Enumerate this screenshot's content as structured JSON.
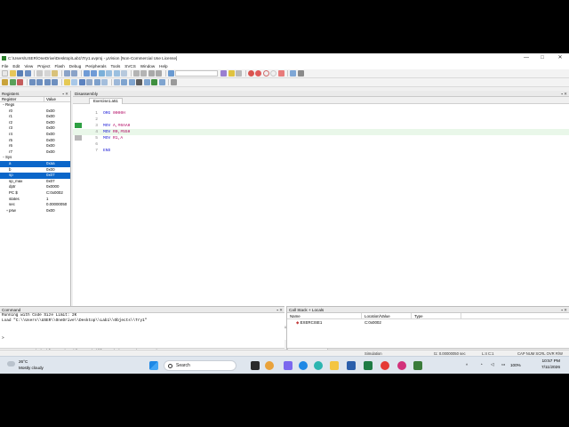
{
  "window": {
    "title": "C:\\Users\\USER\\OneDrive\\Desktop\\Lab1\\Try1.uvproj - µVision  [Non-Commercial Use License]",
    "minimize": "—",
    "maximize": "□",
    "close": "✕"
  },
  "menu": [
    "File",
    "Edit",
    "View",
    "Project",
    "Flash",
    "Debug",
    "Peripherals",
    "Tools",
    "SVCS",
    "Window",
    "Help"
  ],
  "registers": {
    "header": "Registers",
    "col_register": "Register",
    "col_value": "Value",
    "rows": [
      {
        "name": "Regs",
        "value": "",
        "indent": 0,
        "expander": "−"
      },
      {
        "name": "r0",
        "value": "0x00",
        "indent": 2
      },
      {
        "name": "r1",
        "value": "0x00",
        "indent": 2
      },
      {
        "name": "r2",
        "value": "0x00",
        "indent": 2
      },
      {
        "name": "r3",
        "value": "0x00",
        "indent": 2
      },
      {
        "name": "r4",
        "value": "0x00",
        "indent": 2
      },
      {
        "name": "r5",
        "value": "0x00",
        "indent": 2
      },
      {
        "name": "r6",
        "value": "0x00",
        "indent": 2
      },
      {
        "name": "r7",
        "value": "0x00",
        "indent": 2
      },
      {
        "name": "Sys",
        "value": "",
        "indent": 0,
        "expander": "−"
      },
      {
        "name": "a",
        "value": "0xaa",
        "indent": 2,
        "selected": true
      },
      {
        "name": "b",
        "value": "0x00",
        "indent": 2
      },
      {
        "name": "sp",
        "value": "0x07",
        "indent": 2,
        "selected": true
      },
      {
        "name": "sp_max",
        "value": "0x07",
        "indent": 2
      },
      {
        "name": "dptr",
        "value": "0x0000",
        "indent": 2
      },
      {
        "name": "PC  $",
        "value": "C:0x0002",
        "indent": 2
      },
      {
        "name": "states",
        "value": "1",
        "indent": 2
      },
      {
        "name": "sec",
        "value": "0.00000050",
        "indent": 2
      },
      {
        "name": "psw",
        "value": "0x00",
        "indent": 1,
        "expander": "+"
      }
    ],
    "tabs": [
      "Project",
      "Registers"
    ]
  },
  "disassembly": {
    "header": "Disassembly",
    "file_tab": "Exercise1.a51",
    "lines": [
      {
        "num": "1",
        "code": "ORG 0000H"
      },
      {
        "num": "2",
        "code": ""
      },
      {
        "num": "3",
        "code": "MOV A,#0AAH"
      },
      {
        "num": "4",
        "code": "MOV R0,#55H",
        "current": true
      },
      {
        "num": "5",
        "code": "MOV R1,A"
      },
      {
        "num": "6",
        "code": ""
      },
      {
        "num": "7",
        "code": "END"
      }
    ]
  },
  "command": {
    "header": "Command",
    "output": [
      "Running with Code Size Limit: 2K",
      "Load \"C:\\\\Users\\\\USER\\\\OneDrive\\\\Desktop\\\\Lab1\\\\Objects\\\\Try1\""
    ],
    "prompt": ">",
    "keywords": "ASM ASSIGN BreakDisable BreakEnable BreakKill BreakList BreakSet BreakAccess COVERAGE COVTOFILE"
  },
  "callstack": {
    "header": "Call Stack + Locals",
    "col_name": "Name",
    "col_location": "Location/Value",
    "col_type": "Type",
    "rows": [
      {
        "name": "EXERCISE1",
        "location": "C:0x0002",
        "type": ""
      }
    ],
    "tabs": [
      "Call Stack + Locals",
      "Memory 1"
    ]
  },
  "status": {
    "mode": "Simulation",
    "time": "t1: 0.00000050 sec",
    "position": "L:4 C:1",
    "flags": "CAP  NUM  SCRL  OVR  R/W"
  },
  "taskbar": {
    "weather_temp": "26°C",
    "weather_desc": "Mostly cloudy",
    "search_label": "Search",
    "battery": "100%",
    "time": "10:57 PM",
    "date": "7/11/2026"
  }
}
